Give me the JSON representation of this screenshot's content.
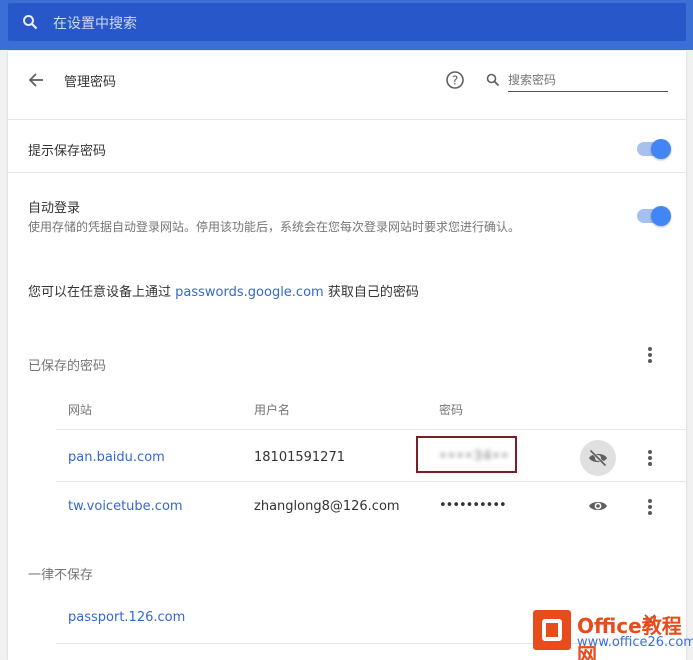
{
  "top_search": {
    "placeholder": "在设置中搜索"
  },
  "header": {
    "title": "管理密码",
    "search_placeholder": "搜索密码"
  },
  "offer_save": {
    "label": "提示保存密码",
    "enabled": true
  },
  "auto_signin": {
    "label": "自动登录",
    "description": "使用存储的凭据自动登录网站。停用该功能后，系统会在您每次登录网站时要求您进行确认。",
    "enabled": true
  },
  "sync_note": {
    "prefix": "您可以在任意设备上通过",
    "link": "passwords.google.com",
    "suffix": "获取自己的密码"
  },
  "saved": {
    "title": "已保存的密码",
    "columns": {
      "site": "网站",
      "username": "用户名",
      "password": "密码"
    },
    "rows": [
      {
        "site": "pan.baidu.com",
        "username": "18101591271",
        "password": "••••34••",
        "visibility_icon": "eye-off-icon"
      },
      {
        "site": "tw.voicetube.com",
        "username": "zhanglong8@126.com",
        "password": "••••••••••",
        "visibility_icon": "eye-icon"
      }
    ]
  },
  "never_saved": {
    "title": "一律不保存",
    "rows": [
      {
        "site": "passport.126.com"
      }
    ]
  },
  "watermark": {
    "brand": "Office教程网",
    "url": "www.office26.com"
  },
  "colors": {
    "accent": "#4285f4",
    "topbar": "#3b6fd6",
    "search_field": "#2757c8",
    "link": "#3367d6",
    "highlight_box": "#7a1f25",
    "watermark": "#e84b1c"
  }
}
